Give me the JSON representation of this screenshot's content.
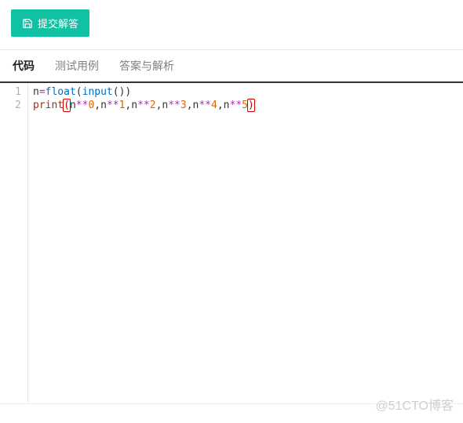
{
  "toolbar": {
    "submit_label": "提交解答",
    "submit_icon": "save-icon"
  },
  "tabs": {
    "items": [
      {
        "label": "代码",
        "active": true
      },
      {
        "label": "测试用例",
        "active": false
      },
      {
        "label": "答案与解析",
        "active": false
      }
    ]
  },
  "editor": {
    "line_numbers": [
      "1",
      "2"
    ],
    "lines": [
      [
        {
          "t": "n",
          "c": "c-ident"
        },
        {
          "t": "=",
          "c": "c-op"
        },
        {
          "t": "float",
          "c": "c-builtin"
        },
        {
          "t": "(",
          "c": "c-ident"
        },
        {
          "t": "input",
          "c": "c-builtin"
        },
        {
          "t": "())",
          "c": "c-ident"
        }
      ],
      [
        {
          "t": "print",
          "c": "c-kw"
        },
        {
          "t": "(",
          "c": "c-paren-err"
        },
        {
          "t": "n",
          "c": "c-ident"
        },
        {
          "t": "**",
          "c": "c-op"
        },
        {
          "t": "0",
          "c": "c-num"
        },
        {
          "t": ",n",
          "c": "c-ident"
        },
        {
          "t": "**",
          "c": "c-op"
        },
        {
          "t": "1",
          "c": "c-num"
        },
        {
          "t": ",n",
          "c": "c-ident"
        },
        {
          "t": "**",
          "c": "c-op"
        },
        {
          "t": "2",
          "c": "c-num"
        },
        {
          "t": ",n",
          "c": "c-ident"
        },
        {
          "t": "**",
          "c": "c-op"
        },
        {
          "t": "3",
          "c": "c-num"
        },
        {
          "t": ",n",
          "c": "c-ident"
        },
        {
          "t": "**",
          "c": "c-op"
        },
        {
          "t": "4",
          "c": "c-num"
        },
        {
          "t": ",n",
          "c": "c-ident"
        },
        {
          "t": "**",
          "c": "c-op"
        },
        {
          "t": "5",
          "c": "c-num"
        },
        {
          "t": ")",
          "c": "c-paren-err"
        }
      ]
    ]
  },
  "watermark": "@51CTO博客",
  "colors": {
    "accent": "#11c1a3",
    "tab_active": "#222222",
    "tab_inactive": "#808080"
  }
}
